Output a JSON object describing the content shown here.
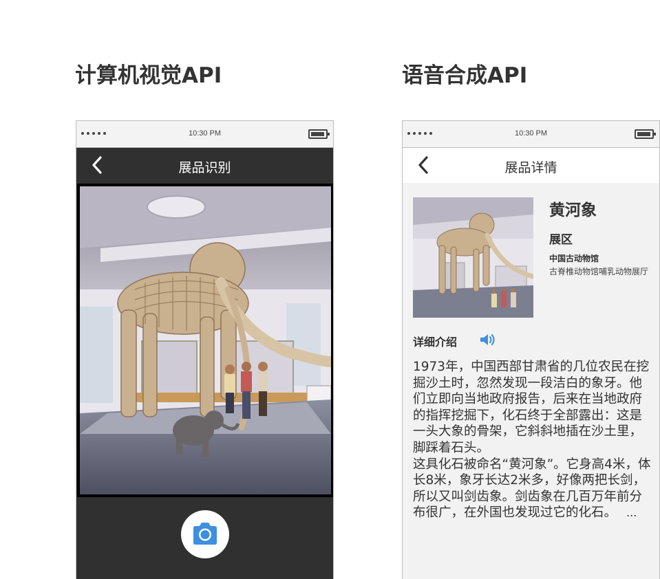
{
  "left_section": {
    "title": "计算机视觉API",
    "status_time": "10:30 PM",
    "nav_title": "展品识别",
    "icons": {
      "back": "chevron-left-icon",
      "shutter": "camera-icon"
    },
    "colors": {
      "nav_bg": "#303030",
      "camera_icon": "#3d8fe0"
    }
  },
  "right_section": {
    "title": "语音合成API",
    "status_time": "10:30 PM",
    "nav_title": "展品详情",
    "exhibit": {
      "name": "黄河象",
      "area_label": "展区",
      "museum": "中国古动物馆",
      "hall": "古脊椎动物馆哺乳动物展厅"
    },
    "detail_heading": "详细介绍",
    "description_p1": "1973年，中国西部甘肃省的几位农民在挖掘沙土时，忽然发现一段洁白的象牙。他们立即向当地政府报告，后来在当地政府的指挥挖掘下，化石终于全部露出：这是一头大象的骨架，它斜斜地插在沙土里，脚踩着石头。",
    "description_p2": "这具化石被命名“黄河象”。它身高4米，体长8米，象牙长达2米多，好像两把长剑，所以又叫剑齿象。剑齿象在几百万年前分布很广，在外国也发现过它的化石。",
    "ellipsis": "...",
    "icons": {
      "back": "chevron-left-icon",
      "speaker": "speaker-icon"
    },
    "colors": {
      "speaker": "#3d8fe0",
      "content_bg": "#f2f2f2"
    }
  }
}
